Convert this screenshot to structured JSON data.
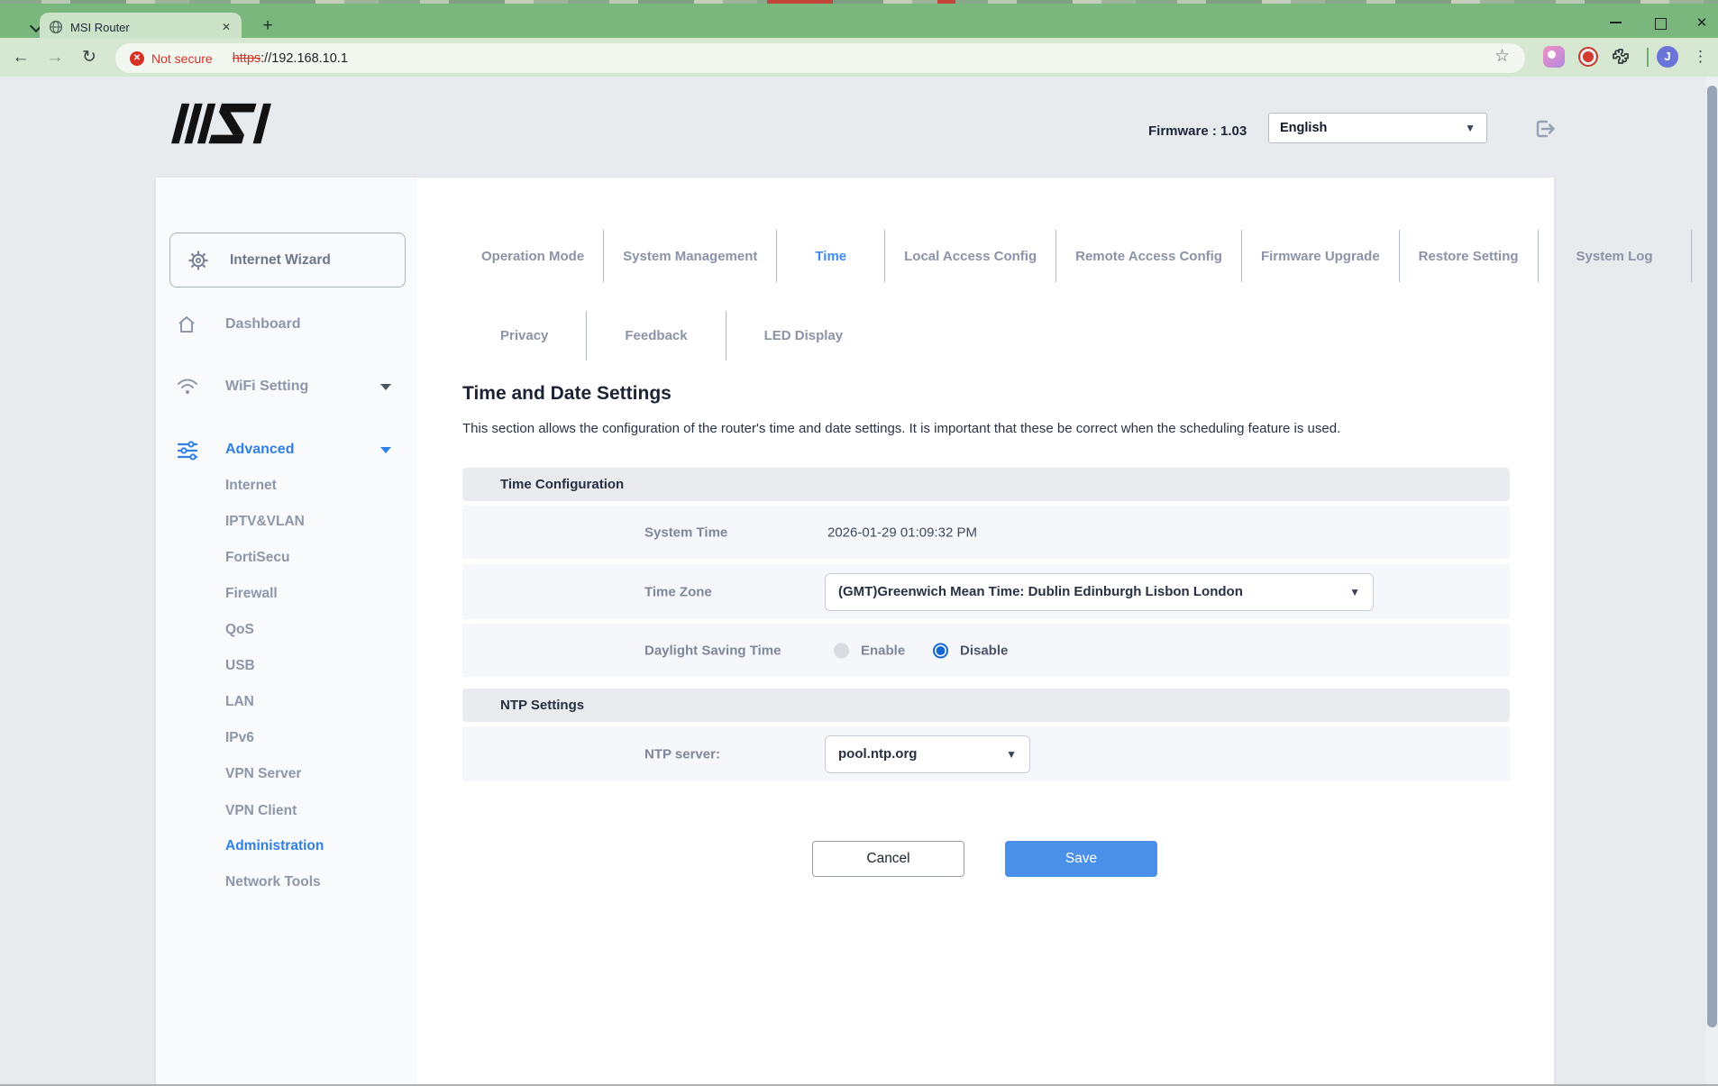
{
  "browser": {
    "tab_title": "MSI Router",
    "new_tab_glyph": "+",
    "tab_close_glyph": "✕",
    "window_close_glyph": "✕",
    "back_glyph": "←",
    "forward_glyph": "→",
    "reload_glyph": "↻",
    "security_label": "Not secure",
    "security_badge_glyph": "✕",
    "url_scheme": "https",
    "url_rest": "://192.168.10.1",
    "bookmark_star_glyph": "☆",
    "menu_dots_glyph": "⋮",
    "avatar_initial": "J"
  },
  "header": {
    "firmware": "Firmware : 1.03",
    "language": "English",
    "dropdown_glyph": "▼"
  },
  "sidebar": {
    "wizard": "Internet Wizard",
    "dashboard": "Dashboard",
    "wifi": "WiFi Setting",
    "advanced": "Advanced",
    "advanced_items": [
      "Internet",
      "IPTV&VLAN",
      "FortiSecu",
      "Firewall",
      "QoS",
      "USB",
      "LAN",
      "IPv6",
      "VPN Server",
      "VPN Client",
      "Administration",
      "Network Tools"
    ],
    "active_item": "Administration"
  },
  "tabs_row1": [
    "Operation Mode",
    "System Management",
    "Time",
    "Local Access Config",
    "Remote Access Config",
    "Firmware Upgrade",
    "Restore Setting",
    "System Log"
  ],
  "active_tab": "Time",
  "tabs_row2": [
    "Privacy",
    "Feedback",
    "LED Display"
  ],
  "page": {
    "title": "Time and Date Settings",
    "description": "This section allows the configuration of the router's time and date settings. It is important that these be correct when the scheduling feature is used.",
    "time_config": {
      "header": "Time Configuration",
      "system_time_label": "System Time",
      "system_time_value": "2026-01-29 01:09:32 PM",
      "time_zone_label": "Time Zone",
      "time_zone_value": "(GMT)Greenwich Mean Time: Dublin Edinburgh Lisbon London",
      "dst_label": "Daylight Saving Time",
      "dst_enable": "Enable",
      "dst_disable": "Disable",
      "dst_selected": "Disable"
    },
    "ntp": {
      "header": "NTP Settings",
      "server_label": "NTP server:",
      "server_value": "pool.ntp.org"
    },
    "cancel": "Cancel",
    "save": "Save"
  },
  "colors": {
    "accent_blue": "#2f80e4",
    "save_button": "#4a90e8",
    "danger_red": "#d93025",
    "chrome_green": "#79b77c"
  }
}
